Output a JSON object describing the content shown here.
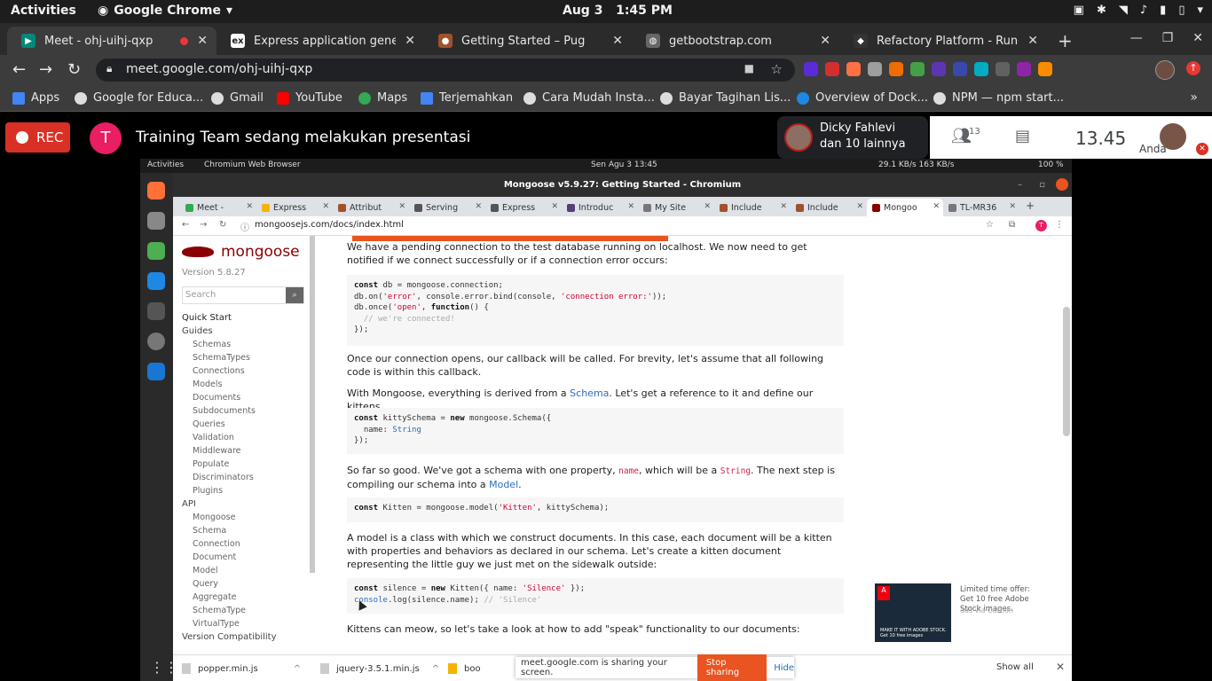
{
  "system": {
    "activities": "Activities",
    "app_name": "Google Chrome",
    "date": "Aug 3",
    "time": "1:45 PM"
  },
  "tabs": [
    {
      "label": "Meet - ohj-uihj-qxp",
      "active": true,
      "recording": true
    },
    {
      "label": "Express application generator",
      "active": false
    },
    {
      "label": "Getting Started – Pug",
      "active": false
    },
    {
      "label": "getbootstrap.com",
      "active": false
    },
    {
      "label": "Refactory Platform - Rundown",
      "active": false
    }
  ],
  "address_bar": {
    "url": "meet.google.com/ohj-uihj-qxp"
  },
  "bookmarks": [
    {
      "label": "Apps"
    },
    {
      "label": "Google for Educa..."
    },
    {
      "label": "Gmail"
    },
    {
      "label": "YouTube"
    },
    {
      "label": "Maps"
    },
    {
      "label": "Terjemahkan"
    },
    {
      "label": "Cara Mudah Insta..."
    },
    {
      "label": "Bayar Tagihan Lis..."
    },
    {
      "label": "Overview of Dock..."
    },
    {
      "label": "NPM — npm start..."
    }
  ],
  "meet": {
    "rec_label": "REC",
    "presenter_initial": "T",
    "presenting_message": "Training Team sedang melakukan presentasi",
    "participant_name": "Dicky Fahlevi",
    "participant_more": "dan 10 lainnya",
    "participant_count": "13",
    "clock": "13.45",
    "self_label": "Anda"
  },
  "shared_screen": {
    "activities": "Activities",
    "browser_menu": "Chromium Web Browser",
    "clock": "Sen Agu 3  13:45",
    "net_stats": "29.1 KB/s   163 KB/s",
    "battery": "100 %",
    "window_title": "Mongoose v5.9.27: Getting Started - Chromium",
    "tabs": [
      {
        "label": "Meet -",
        "color": "#34a853"
      },
      {
        "label": "Express",
        "color": "#f4b400"
      },
      {
        "label": "Attribut",
        "color": "#a0522d"
      },
      {
        "label": "Serving",
        "color": "#555555"
      },
      {
        "label": "Express",
        "color": "#555555"
      },
      {
        "label": "Introduc",
        "color": "#563d7c"
      },
      {
        "label": "My Site",
        "color": "#777777"
      },
      {
        "label": "Include",
        "color": "#a0522d"
      },
      {
        "label": "Include",
        "color": "#a0522d"
      },
      {
        "label": "Mongoo",
        "color": "#880000",
        "active": true
      },
      {
        "label": "TL-MR36",
        "color": "#777777"
      }
    ],
    "url": "mongoosejs.com/docs/index.html",
    "sidebar": {
      "brand": "mongoose",
      "version": "Version 5.8.27",
      "search_placeholder": "Search",
      "quick_start": "Quick Start",
      "guides": "Guides",
      "guide_items": [
        "Schemas",
        "SchemaTypes",
        "Connections",
        "Models",
        "Documents",
        "Subdocuments",
        "Queries",
        "Validation",
        "Middleware",
        "Populate",
        "Discriminators",
        "Plugins"
      ],
      "api": "API",
      "api_items": [
        "Mongoose",
        "Schema",
        "Connection",
        "Document",
        "Model",
        "Query",
        "Aggregate",
        "SchemaType",
        "VirtualType"
      ],
      "compat": "Version Compatibility"
    },
    "content": {
      "p1": "We have a pending connection to the test database running on localhost. We now need to get notified if we connect successfully or if a connection error occurs:",
      "p2": "Once our connection opens, our callback will be called. For brevity, let's assume that all following code is within this callback.",
      "p3_pre": "With Mongoose, everything is derived from a ",
      "p3_link": "Schema",
      "p3_post": ". Let's get a reference to it and define our kittens.",
      "p4_a": "So far so good. We've got a schema with one property, ",
      "p4_code1": "name",
      "p4_b": ", which will be a ",
      "p4_code2": "String",
      "p4_c": ". The next step is compiling our schema into a ",
      "p4_link": "Model",
      "p4_d": ".",
      "p5": "A model is a class with which we construct documents. In this case, each document will be a kitten with properties and behaviors as declared in our schema. Let's create a kitten document representing the little guy we just met on the sidewalk outside:",
      "p6": "Kittens can meow, so let's take a look at how to add \"speak\" functionality to our documents:"
    },
    "ad": {
      "copy": "Limited time offer: Get 10 free Adobe Stock images.",
      "by": "ads via Carbon",
      "image_text": "MAKE IT WITH ADOBE STOCK. Get 10 free images"
    },
    "downloads": [
      {
        "label": "popper.min.js"
      },
      {
        "label": "jquery-3.5.1.min.js"
      },
      {
        "label": "boo"
      }
    ],
    "share_notice": "meet.google.com is sharing your screen.",
    "stop_sharing": "Stop sharing",
    "hide": "Hide",
    "show_all": "Show all"
  }
}
